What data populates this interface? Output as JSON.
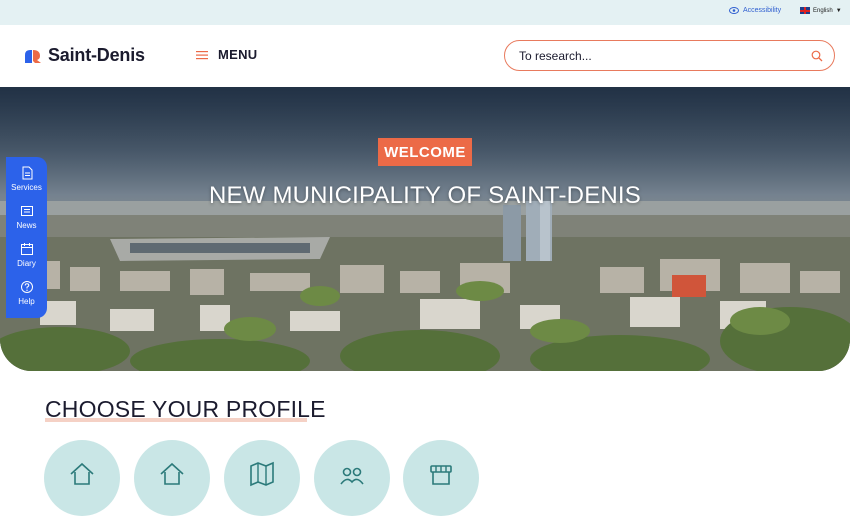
{
  "topbar": {
    "accessibility_label": "Accessibility",
    "language_label": "English"
  },
  "header": {
    "logo_text": "Saint-Denis",
    "menu_label": "MENU",
    "search_placeholder": "To research..."
  },
  "hero": {
    "badge": "WELCOME",
    "title": "NEW MUNICIPALITY OF SAINT-DENIS"
  },
  "quick_access": [
    {
      "label": "Services",
      "icon": "document-icon"
    },
    {
      "label": "News",
      "icon": "newspaper-icon"
    },
    {
      "label": "Diary",
      "icon": "calendar-icon"
    },
    {
      "label": "Help",
      "icon": "help-circle-icon"
    }
  ],
  "profiles": {
    "title": "CHOOSE YOUR PROFILE",
    "items": [
      {
        "icon": "house-icon"
      },
      {
        "icon": "house-heart-icon"
      },
      {
        "icon": "map-icon"
      },
      {
        "icon": "people-icon"
      },
      {
        "icon": "shop-icon"
      }
    ]
  },
  "colors": {
    "accent_orange": "#ec6a47",
    "brand_blue": "#2c62ea",
    "topbar_bg": "#e4f1f3",
    "profile_circle": "#c9e6e6"
  }
}
